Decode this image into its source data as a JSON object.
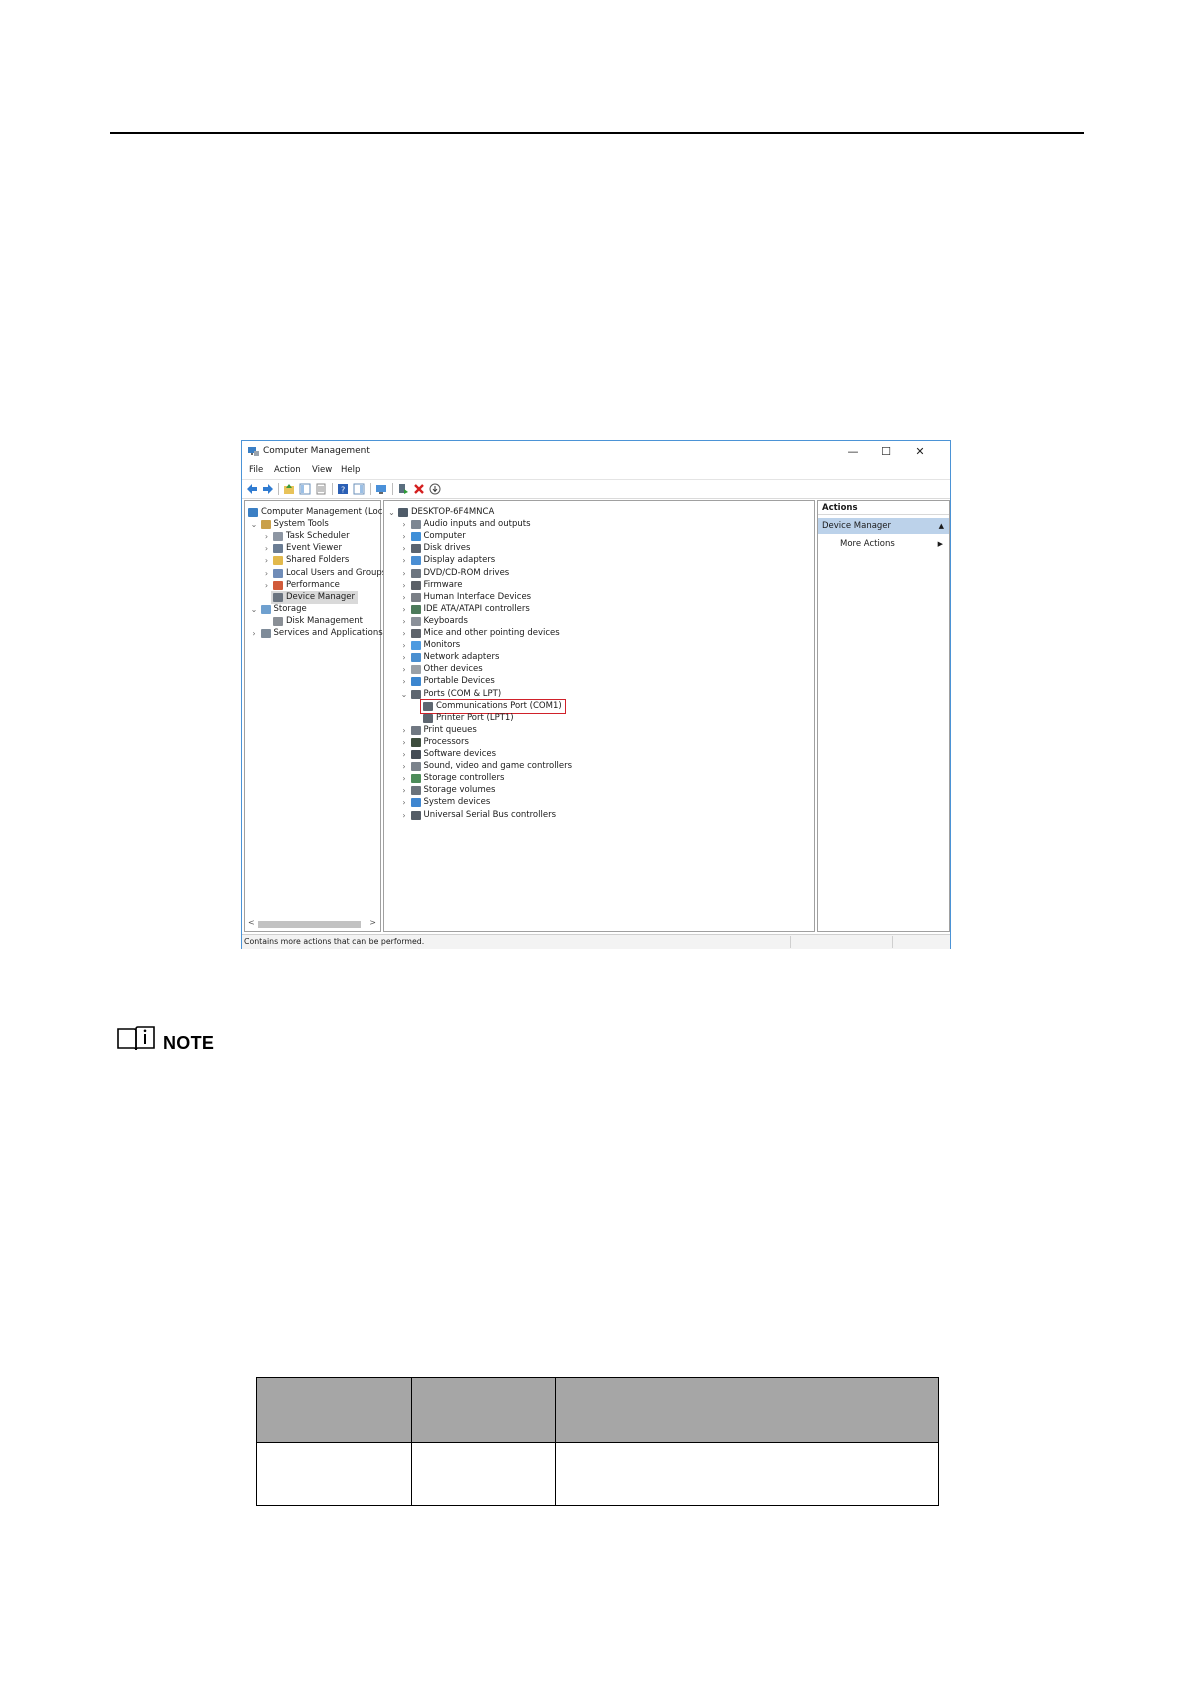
{
  "screenshot": {
    "window_title": "Computer Management",
    "menu": [
      "File",
      "Action",
      "View",
      "Help"
    ],
    "window_controls": {
      "minimize": "—",
      "maximize": "☐",
      "close": "✕"
    },
    "left_tree": [
      {
        "label": "Computer Management (Local",
        "icon": "computer-management-icon",
        "chevron": "",
        "level": 0
      },
      {
        "label": "System Tools",
        "icon": "system-tools-icon",
        "chevron": "⌄",
        "level": 1
      },
      {
        "label": "Task Scheduler",
        "icon": "task-scheduler-icon",
        "chevron": "›",
        "level": 2
      },
      {
        "label": "Event Viewer",
        "icon": "event-viewer-icon",
        "chevron": "›",
        "level": 2
      },
      {
        "label": "Shared Folders",
        "icon": "shared-folders-icon",
        "chevron": "›",
        "level": 2
      },
      {
        "label": "Local Users and Groups",
        "icon": "users-icon",
        "chevron": "›",
        "level": 2
      },
      {
        "label": "Performance",
        "icon": "performance-icon",
        "chevron": "›",
        "level": 2
      },
      {
        "label": "Device Manager",
        "icon": "device-manager-icon",
        "chevron": "",
        "level": 2,
        "selected": true
      },
      {
        "label": "Storage",
        "icon": "storage-icon",
        "chevron": "⌄",
        "level": 1
      },
      {
        "label": "Disk Management",
        "icon": "disk-management-icon",
        "chevron": "",
        "level": 2
      },
      {
        "label": "Services and Applications",
        "icon": "services-icon",
        "chevron": "›",
        "level": 1
      }
    ],
    "device_tree": [
      {
        "label": "DESKTOP-6F4MNCA",
        "icon": "desktop-computer-icon",
        "chevron": "⌄",
        "level": 0
      },
      {
        "label": "Audio inputs and outputs",
        "icon": "audio-icon",
        "chevron": "›",
        "level": 1
      },
      {
        "label": "Computer",
        "icon": "computer-icon",
        "chevron": "›",
        "level": 1
      },
      {
        "label": "Disk drives",
        "icon": "disk-drive-icon",
        "chevron": "›",
        "level": 1
      },
      {
        "label": "Display adapters",
        "icon": "display-adapter-icon",
        "chevron": "›",
        "level": 1
      },
      {
        "label": "DVD/CD-ROM drives",
        "icon": "dvd-icon",
        "chevron": "›",
        "level": 1
      },
      {
        "label": "Firmware",
        "icon": "firmware-icon",
        "chevron": "›",
        "level": 1
      },
      {
        "label": "Human Interface Devices",
        "icon": "hid-icon",
        "chevron": "›",
        "level": 1
      },
      {
        "label": "IDE ATA/ATAPI controllers",
        "icon": "ide-controller-icon",
        "chevron": "›",
        "level": 1
      },
      {
        "label": "Keyboards",
        "icon": "keyboard-icon",
        "chevron": "›",
        "level": 1
      },
      {
        "label": "Mice and other pointing devices",
        "icon": "mouse-icon",
        "chevron": "›",
        "level": 1
      },
      {
        "label": "Monitors",
        "icon": "monitor-icon",
        "chevron": "›",
        "level": 1
      },
      {
        "label": "Network adapters",
        "icon": "network-adapter-icon",
        "chevron": "›",
        "level": 1
      },
      {
        "label": "Other devices",
        "icon": "other-devices-icon",
        "chevron": "›",
        "level": 1
      },
      {
        "label": "Portable Devices",
        "icon": "portable-device-icon",
        "chevron": "›",
        "level": 1
      },
      {
        "label": "Ports (COM & LPT)",
        "icon": "port-icon",
        "chevron": "⌄",
        "level": 1
      },
      {
        "label": "Communications Port (COM1)",
        "icon": "port-icon",
        "chevron": "",
        "level": 2,
        "highlighted": true
      },
      {
        "label": "Printer Port (LPT1)",
        "icon": "port-icon",
        "chevron": "",
        "level": 2
      },
      {
        "label": "Print queues",
        "icon": "printer-icon",
        "chevron": "›",
        "level": 1
      },
      {
        "label": "Processors",
        "icon": "processor-icon",
        "chevron": "›",
        "level": 1
      },
      {
        "label": "Software devices",
        "icon": "software-device-icon",
        "chevron": "›",
        "level": 1
      },
      {
        "label": "Sound, video and game controllers",
        "icon": "sound-icon",
        "chevron": "›",
        "level": 1
      },
      {
        "label": "Storage controllers",
        "icon": "storage-controller-icon",
        "chevron": "›",
        "level": 1
      },
      {
        "label": "Storage volumes",
        "icon": "storage-volume-icon",
        "chevron": "›",
        "level": 1
      },
      {
        "label": "System devices",
        "icon": "system-devices-icon",
        "chevron": "›",
        "level": 1
      },
      {
        "label": "Universal Serial Bus controllers",
        "icon": "usb-icon",
        "chevron": "›",
        "level": 1
      }
    ],
    "actions": {
      "header": "Actions",
      "section": "Device Manager",
      "section_arrow": "▲",
      "more": "More Actions",
      "more_arrow": "▶"
    },
    "status": "Contains more actions that can be performed.",
    "highlight_color": "#d0212a"
  },
  "note": {
    "label": "NOTE",
    "icon_glyph": "i"
  }
}
